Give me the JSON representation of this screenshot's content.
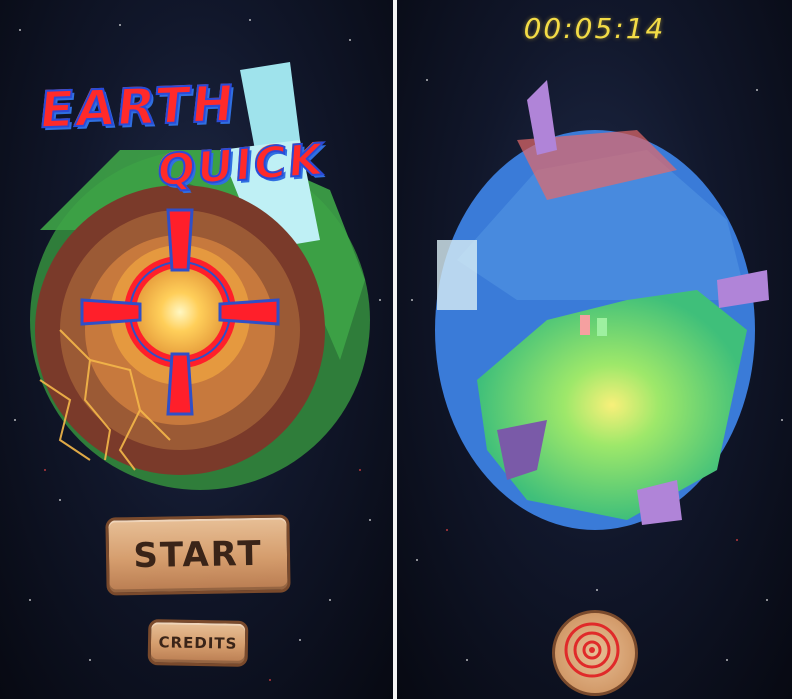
{
  "menu_screen": {
    "title_line1": "EARTH",
    "title_line2": "QUICK",
    "start_label": "START",
    "credits_label": "CREDITS"
  },
  "game_screen": {
    "timer": "00:05:14",
    "target_button_icon": "target-icon"
  },
  "colors": {
    "title_red": "#ff2a2a",
    "title_blue": "#2f6fe0",
    "crosshair_red": "#ff1f2a",
    "timer_yellow": "#f3dc46",
    "wood": "#d59d6d"
  }
}
